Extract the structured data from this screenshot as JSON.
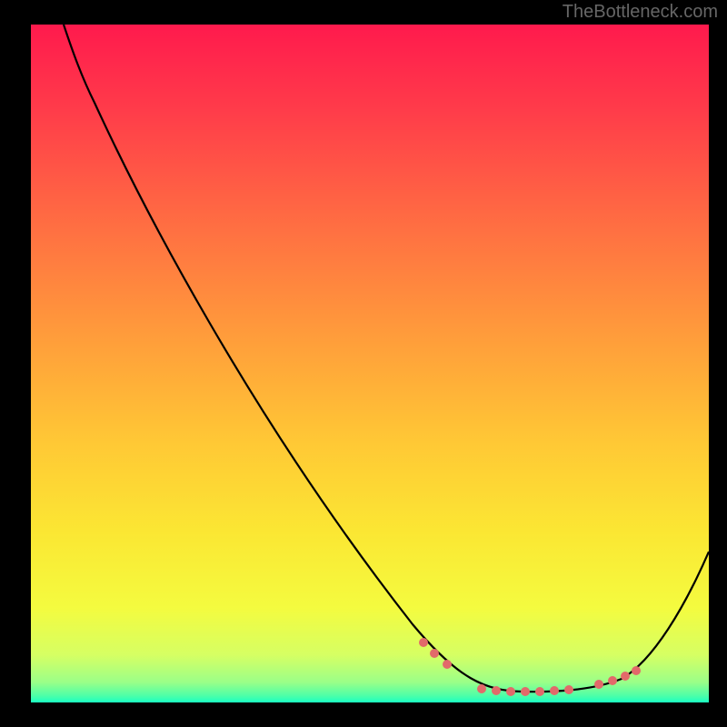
{
  "watermark": "TheBottleneck.com",
  "chart_data": {
    "type": "line",
    "title": "",
    "xlabel": "",
    "ylabel": "",
    "xlim": [
      0,
      100
    ],
    "ylim": [
      0,
      100
    ],
    "grid": false,
    "background_gradient": {
      "direction": "vertical",
      "stops": [
        {
          "pct": 0,
          "color": "#ff1a4d"
        },
        {
          "pct": 30,
          "color": "#ff6f42"
        },
        {
          "pct": 62,
          "color": "#ffc935"
        },
        {
          "pct": 86,
          "color": "#f4fb3f"
        },
        {
          "pct": 99,
          "color": "#4dffa8"
        },
        {
          "pct": 100,
          "color": "#1affc2"
        }
      ]
    },
    "series": [
      {
        "name": "bottleneck-curve",
        "style": "solid",
        "color": "#000000",
        "x": [
          5,
          10,
          20,
          30,
          40,
          50,
          57,
          63,
          67,
          70,
          73,
          76,
          79,
          82,
          85,
          88,
          92,
          96,
          100
        ],
        "y": [
          100,
          92,
          78,
          64,
          50,
          36,
          24,
          14,
          8,
          4,
          2,
          1.5,
          1.2,
          1.2,
          1.5,
          3,
          8,
          15,
          22
        ]
      }
    ],
    "markers": {
      "name": "optimal-range-dots",
      "color": "#e26a6a",
      "x": [
        58,
        60,
        62,
        67,
        69,
        71,
        73,
        75,
        77,
        79,
        84,
        86,
        88,
        89
      ],
      "y": [
        9,
        7,
        6,
        2,
        1.5,
        1.3,
        1.2,
        1.2,
        1.3,
        1.4,
        2.6,
        3.2,
        3.8,
        4.5
      ]
    },
    "annotations": []
  }
}
